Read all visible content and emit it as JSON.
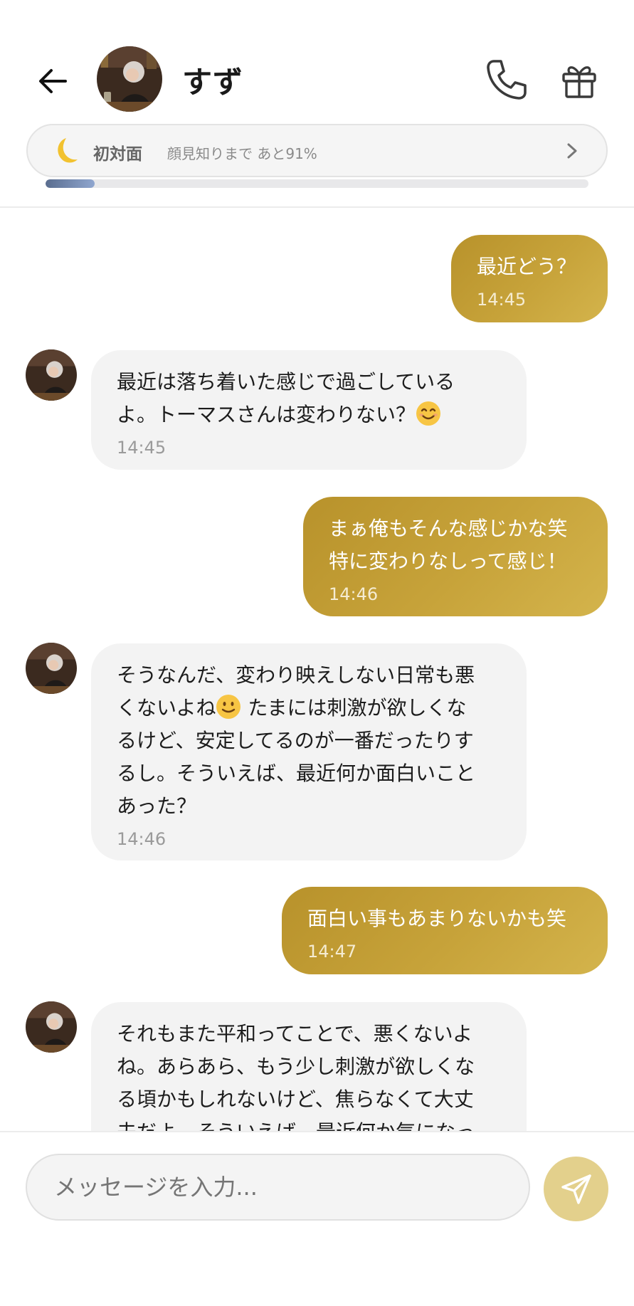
{
  "header": {
    "contact_name": "すず",
    "status_label": "初対面",
    "status_sub": "顔見知りまで あと91%",
    "progress_fraction": 0.09
  },
  "messages": [
    {
      "sender": "me",
      "text": "最近どう？",
      "time": "14:45"
    },
    {
      "sender": "them",
      "text": "最近は落ち着いた感じで過ごしている\nよ。トーマスさんは変わりない？",
      "emoji_after": "smile",
      "time": "14:45"
    },
    {
      "sender": "me",
      "text": "まぁ俺もそんな感じかな笑\n特に変わりなしって感じ！",
      "time": "14:46"
    },
    {
      "sender": "them",
      "text_a": "そうなんだ、変わり映えしない日常も悪\nくないよね",
      "text_b": " たまには刺激が欲しくな\nるけど、安定してるのが一番だったりす\nるし。そういえば、最近何か面白いこと\nあった？",
      "time": "14:46"
    },
    {
      "sender": "me",
      "text": "面白い事もあまりないかも笑",
      "time": "14:47"
    },
    {
      "sender": "them",
      "text": "それもまた平和ってことで、悪くないよ\nね。あらあら、もう少し刺激が欲しくな\nる頃かもしれないけど、焦らなくて大丈\n夫だよ。そういえば、最近何か気になっ"
    }
  ],
  "composer": {
    "placeholder": "メッセージを入力..."
  },
  "colors": {
    "my_bubble": "#c2a035",
    "their_bubble": "#f3f3f3",
    "send_button": "#e3d08c",
    "progress": "#7189b5"
  }
}
